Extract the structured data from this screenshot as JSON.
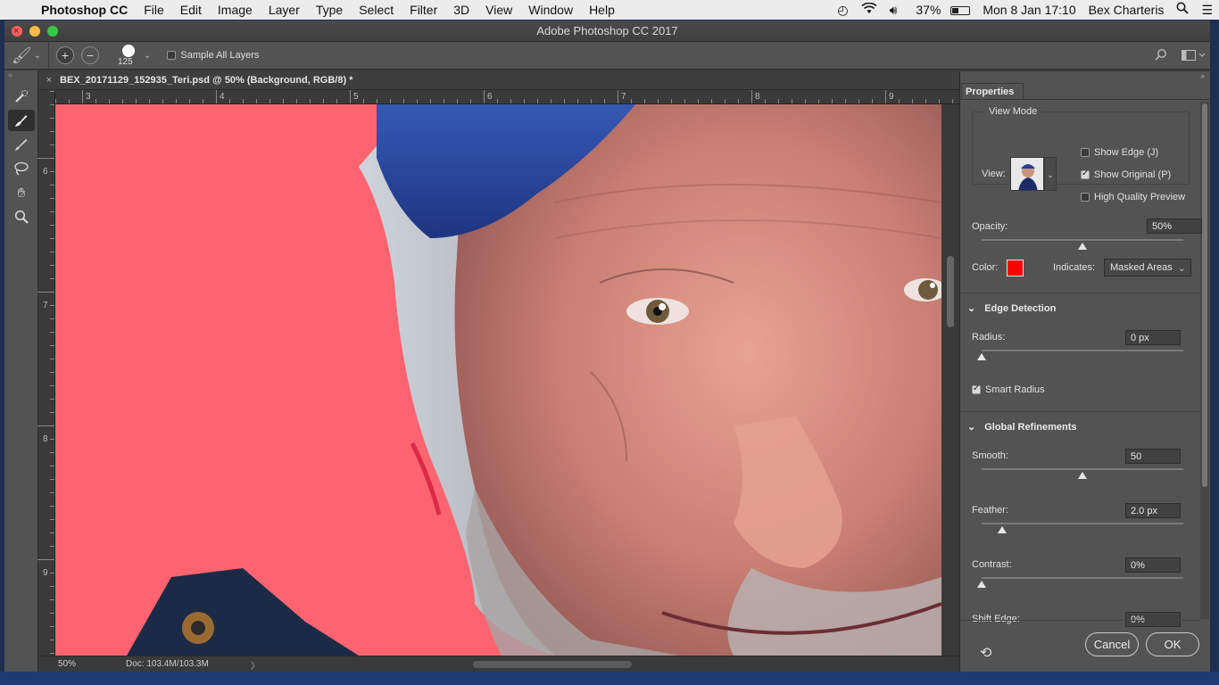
{
  "menubar": {
    "app_name": "Photoshop CC",
    "menus": [
      "File",
      "Edit",
      "Image",
      "Layer",
      "Type",
      "Select",
      "Filter",
      "3D",
      "View",
      "Window",
      "Help"
    ],
    "battery": "37%",
    "datetime": "Mon 8 Jan  17:10",
    "user": "Bex Charteris"
  },
  "window": {
    "title": "Adobe Photoshop CC 2017"
  },
  "options": {
    "brush_size": "125",
    "sample_all_layers": "Sample All Layers"
  },
  "document": {
    "tab_title": "BEX_20171129_152935_Teri.psd @ 50% (Background, RGB/8) *",
    "ruler_h": [
      "3",
      "4",
      "5",
      "6",
      "7",
      "8",
      "9"
    ],
    "ruler_v": [
      "6",
      "7",
      "8",
      "9"
    ],
    "zoom": "50%",
    "doc_size": "Doc: 103.4M/103.3M"
  },
  "properties": {
    "tab": "Properties",
    "view_mode": {
      "legend": "View Mode",
      "view_label": "View:",
      "show_edge": "Show Edge (J)",
      "show_edge_checked": false,
      "show_original": "Show Original (P)",
      "show_original_checked": true,
      "high_quality": "High Quality Preview",
      "high_quality_checked": false
    },
    "opacity": {
      "label": "Opacity:",
      "value": "50%",
      "level": 0.5
    },
    "color": {
      "label": "Color:",
      "swatch": "#ff0000"
    },
    "indicates": {
      "label": "Indicates:",
      "value": "Masked Areas"
    },
    "edge_detection": {
      "title": "Edge Detection",
      "radius_label": "Radius:",
      "radius_value": "0 px",
      "radius_level": 0,
      "smart_radius": "Smart Radius",
      "smart_radius_checked": true
    },
    "global_refinements": {
      "title": "Global Refinements",
      "smooth_label": "Smooth:",
      "smooth_value": "50",
      "smooth_level": 0.5,
      "feather_label": "Feather:",
      "feather_value": "2.0 px",
      "feather_level": 0.1,
      "contrast_label": "Contrast:",
      "contrast_value": "0%",
      "contrast_level": 0,
      "shift_label": "Shift Edge:",
      "shift_value": "0%"
    },
    "buttons": {
      "cancel": "Cancel",
      "ok": "OK"
    }
  },
  "colors": {
    "mask_overlay": "#fe6470",
    "panel_bg": "#535353",
    "cap": "#2f4fa3"
  }
}
